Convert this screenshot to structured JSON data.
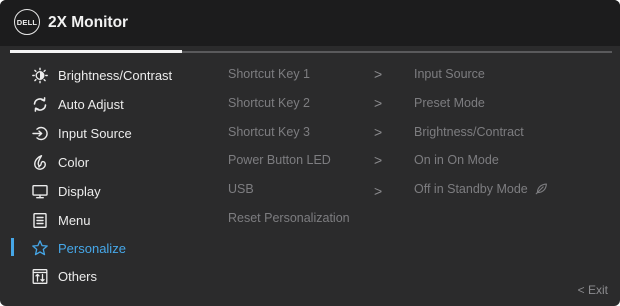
{
  "header": {
    "logo_text": "DELL",
    "title": "2X Monitor"
  },
  "colors": {
    "panel_bg": "#2b2b2c",
    "header_bg": "#1c1c1d",
    "accent": "#46a7e8",
    "text_primary": "#ececec",
    "text_muted": "#7d7d80"
  },
  "menu": {
    "items": [
      {
        "label": "Brightness/Contrast",
        "icon": "brightness-icon"
      },
      {
        "label": "Auto Adjust",
        "icon": "auto-adjust-icon"
      },
      {
        "label": "Input Source",
        "icon": "input-source-icon"
      },
      {
        "label": "Color",
        "icon": "color-icon"
      },
      {
        "label": "Display",
        "icon": "display-icon"
      },
      {
        "label": "Menu",
        "icon": "menu-icon"
      },
      {
        "label": "Personalize",
        "icon": "star-icon"
      },
      {
        "label": "Others",
        "icon": "others-icon"
      }
    ],
    "selected": "Personalize"
  },
  "personalize": {
    "rows": [
      {
        "key": "Shortcut Key 1",
        "chevron": ">",
        "value": "Input Source"
      },
      {
        "key": "Shortcut Key 2",
        "chevron": ">",
        "value": "Preset Mode"
      },
      {
        "key": "Shortcut Key 3",
        "chevron": ">",
        "value": "Brightness/Contract"
      },
      {
        "key": "Power Button LED",
        "chevron": ">",
        "value": "On in On Mode"
      },
      {
        "key": "USB",
        "chevron": ">",
        "value": "Off in Standby Mode"
      },
      {
        "key": "Reset Personalization",
        "chevron": "",
        "value": ""
      }
    ]
  },
  "footer": {
    "exit_label": "< Exit"
  }
}
